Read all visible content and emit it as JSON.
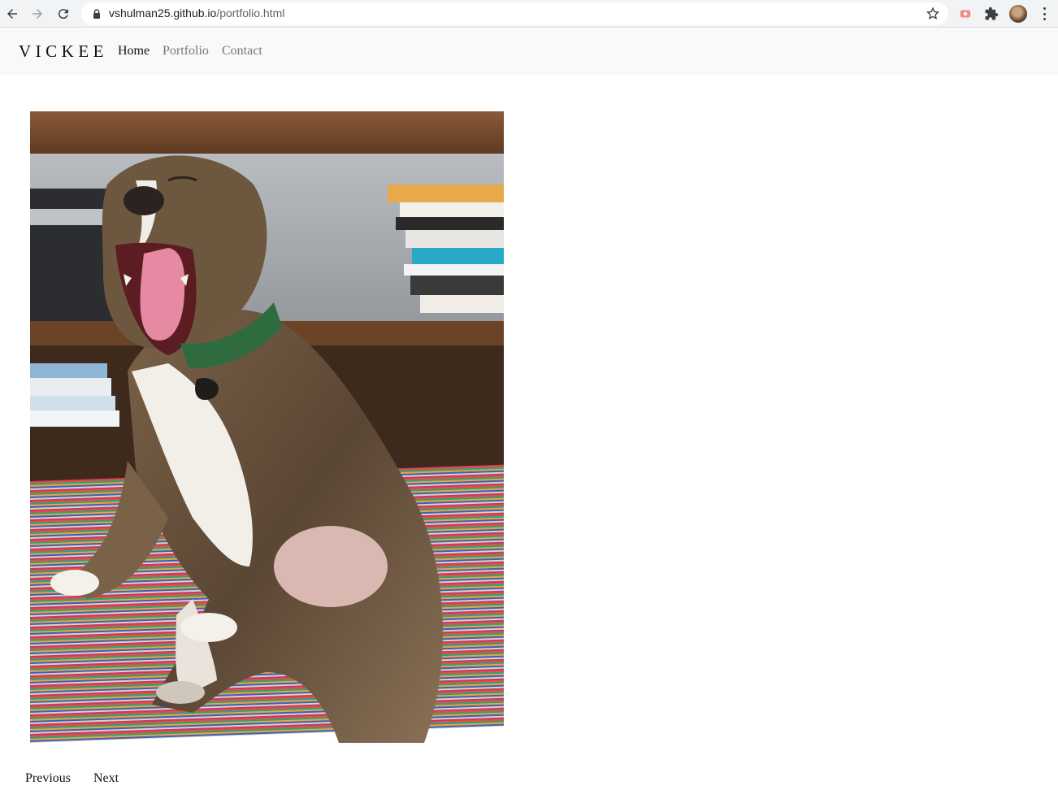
{
  "browser": {
    "url_host": "vshulman25.github.io",
    "url_path": "/portfolio.html"
  },
  "site": {
    "brand": "VICKEE",
    "nav": [
      {
        "label": "Home",
        "active": true
      },
      {
        "label": "Portfolio",
        "active": false
      },
      {
        "label": "Contact",
        "active": false
      }
    ]
  },
  "gallery": {
    "image_alt": "Brindle dog yawning while sitting on a striped rug",
    "prev_label": "Previous",
    "next_label": "Next"
  },
  "colors": {
    "nav_bg": "#f8f9fa",
    "link_muted": "#777777",
    "link_active": "#111111"
  },
  "icons": [
    "back-arrow-icon",
    "forward-arrow-icon",
    "reload-icon",
    "lock-icon",
    "bookmark-star-icon",
    "extension-icon",
    "puzzle-icon",
    "profile-avatar",
    "menu-kebab-icon"
  ]
}
